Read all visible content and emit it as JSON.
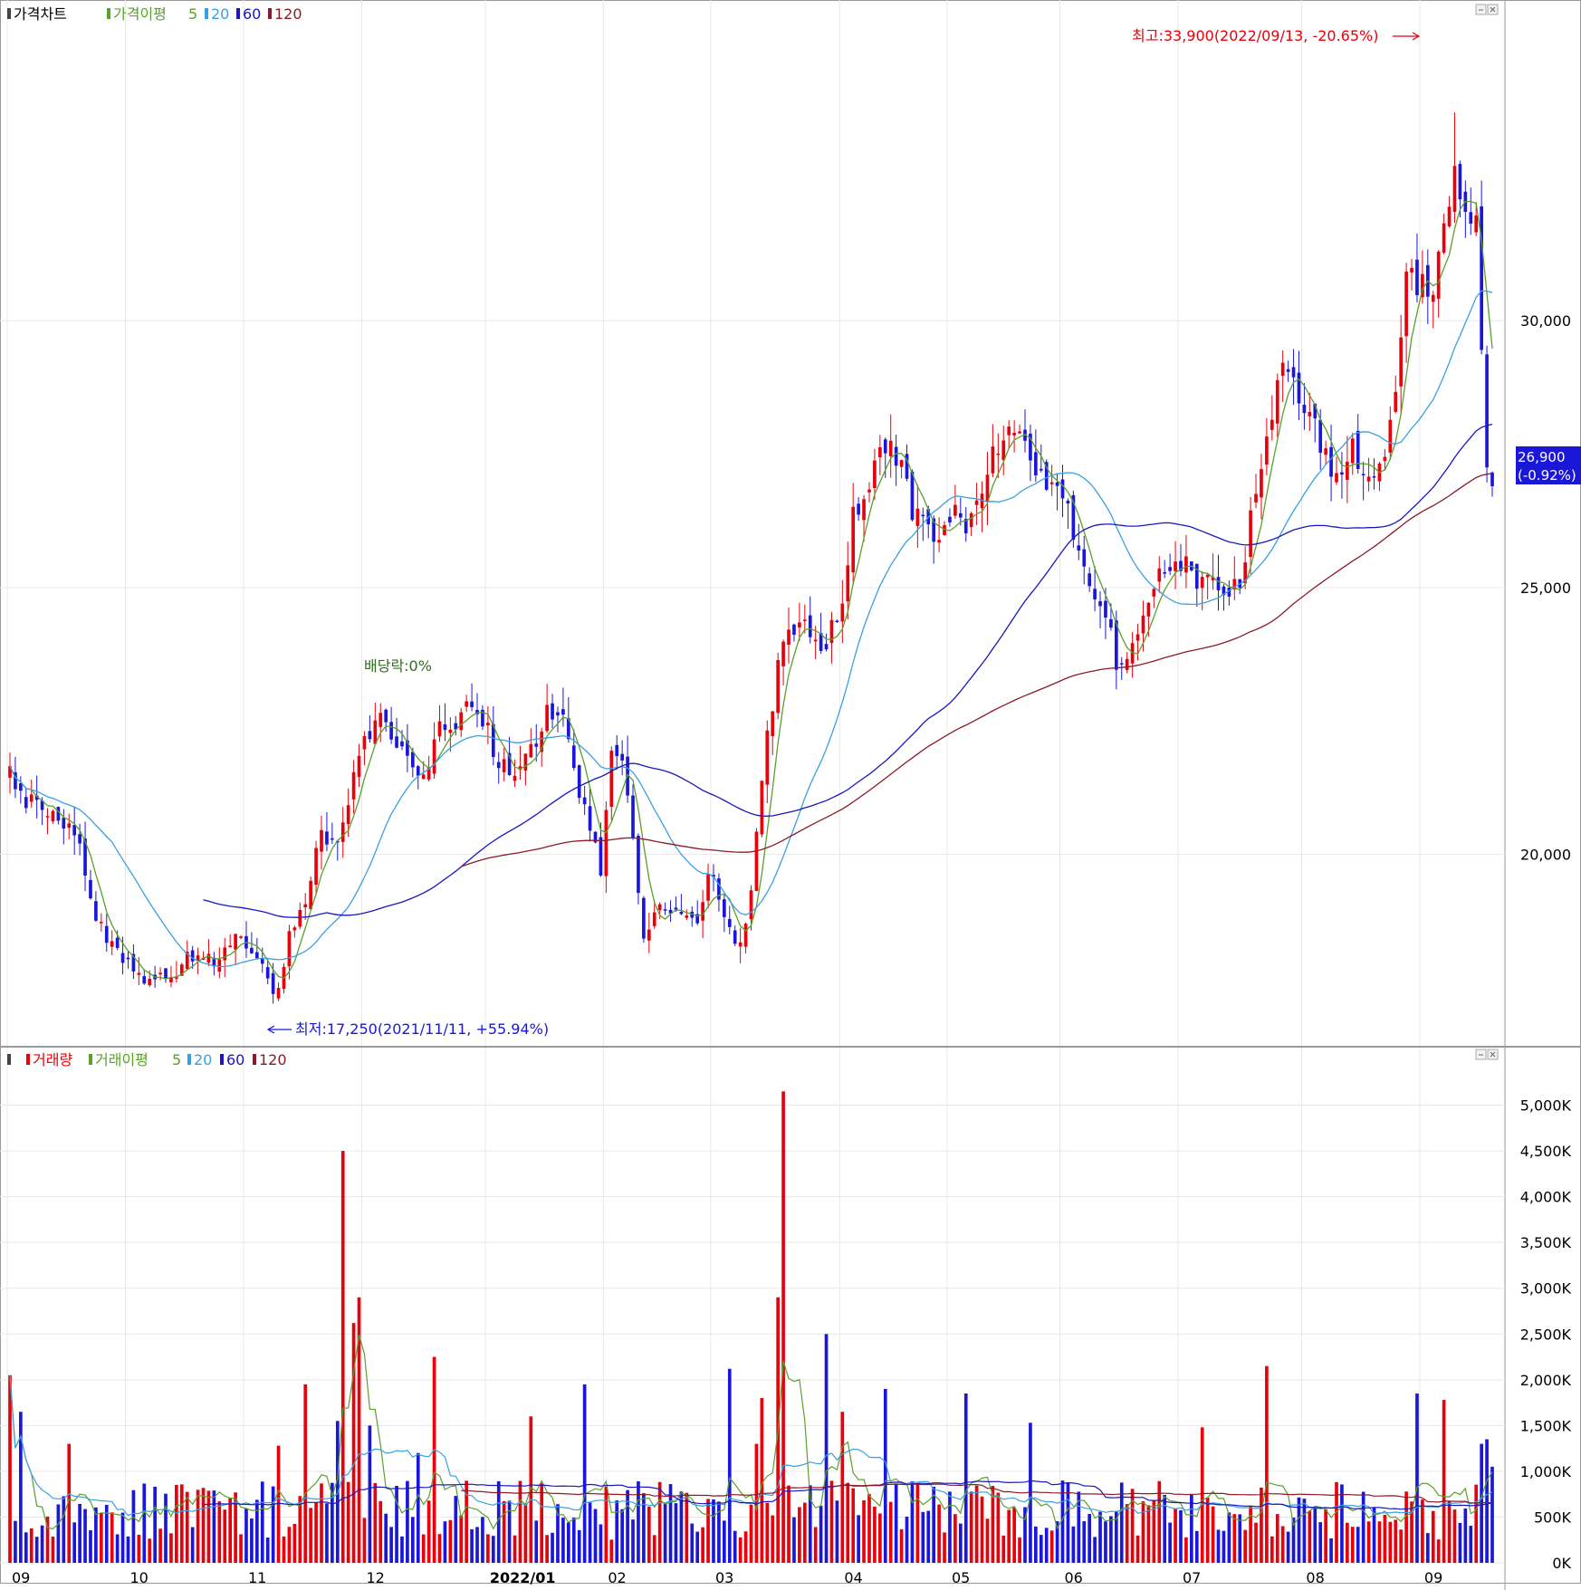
{
  "legend_price": {
    "name": "가격차트",
    "ma_label": "가격이평",
    "periods": [
      "5",
      "20",
      "60",
      "120"
    ]
  },
  "legend_volume": {
    "name": "거래량",
    "ma_label": "거래이평",
    "periods": [
      "5",
      "20",
      "60",
      "120"
    ]
  },
  "colors": {
    "up": "#e8000b",
    "down": "#1a17d8",
    "ma5": "#5aa02c",
    "ma20": "#3aa0e0",
    "ma60": "#1a17c0",
    "ma120": "#8b1a2a",
    "grid": "#e8e8e8"
  },
  "chart_data": [
    {
      "type": "candlestick",
      "name": "price",
      "ylim": [
        16500,
        35500
      ],
      "y_ticks": [
        20000,
        25000,
        30000
      ],
      "y_tick_labels": [
        "20,000",
        "25,000",
        "30,000"
      ],
      "x_month_labels": [
        "09",
        "10",
        "11",
        "12",
        "2022/01",
        "02",
        "03",
        "04",
        "05",
        "06",
        "07",
        "08",
        "09"
      ],
      "month_start_index": [
        0,
        22,
        44,
        66,
        89,
        111,
        131,
        155,
        175,
        196,
        218,
        241,
        263
      ],
      "bar_count": 277,
      "anchors": [
        [
          0,
          21500
        ],
        [
          3,
          21000
        ],
        [
          8,
          20700
        ],
        [
          12,
          20500
        ],
        [
          16,
          18700
        ],
        [
          22,
          18000
        ],
        [
          25,
          17600
        ],
        [
          30,
          17800
        ],
        [
          34,
          18100
        ],
        [
          38,
          18000
        ],
        [
          42,
          18400
        ],
        [
          46,
          18200
        ],
        [
          50,
          17250
        ],
        [
          52,
          18600
        ],
        [
          55,
          19200
        ],
        [
          58,
          20400
        ],
        [
          61,
          20200
        ],
        [
          64,
          21500
        ],
        [
          68,
          22600
        ],
        [
          71,
          22300
        ],
        [
          74,
          21900
        ],
        [
          77,
          21400
        ],
        [
          80,
          22600
        ],
        [
          83,
          22400
        ],
        [
          86,
          22900
        ],
        [
          88,
          22600
        ],
        [
          91,
          21700
        ],
        [
          94,
          21400
        ],
        [
          97,
          21900
        ],
        [
          100,
          22700
        ],
        [
          103,
          22500
        ],
        [
          106,
          21000
        ],
        [
          108,
          20600
        ],
        [
          110,
          19500
        ],
        [
          112,
          21800
        ],
        [
          114,
          21600
        ],
        [
          116,
          20300
        ],
        [
          118,
          18500
        ],
        [
          121,
          18900
        ],
        [
          124,
          18800
        ],
        [
          128,
          18700
        ],
        [
          130,
          19800
        ],
        [
          132,
          19200
        ],
        [
          134,
          18500
        ],
        [
          136,
          18200
        ],
        [
          138,
          19300
        ],
        [
          140,
          21500
        ],
        [
          142,
          22800
        ],
        [
          144,
          24200
        ],
        [
          146,
          24300
        ],
        [
          149,
          24200
        ],
        [
          152,
          23900
        ],
        [
          155,
          24900
        ],
        [
          157,
          26300
        ],
        [
          159,
          26600
        ],
        [
          161,
          27500
        ],
        [
          164,
          27600
        ],
        [
          166,
          27300
        ],
        [
          168,
          26500
        ],
        [
          170,
          26200
        ],
        [
          173,
          26000
        ],
        [
          176,
          26500
        ],
        [
          178,
          26100
        ],
        [
          181,
          26700
        ],
        [
          183,
          27700
        ],
        [
          186,
          27800
        ],
        [
          189,
          27900
        ],
        [
          192,
          27000
        ],
        [
          194,
          26900
        ],
        [
          196,
          26700
        ],
        [
          199,
          25700
        ],
        [
          202,
          24900
        ],
        [
          204,
          24600
        ],
        [
          206,
          23500
        ],
        [
          208,
          23700
        ],
        [
          210,
          24300
        ],
        [
          213,
          25100
        ],
        [
          216,
          25200
        ],
        [
          219,
          25600
        ],
        [
          221,
          25200
        ],
        [
          223,
          25300
        ],
        [
          226,
          24800
        ],
        [
          229,
          25100
        ],
        [
          231,
          26300
        ],
        [
          234,
          28000
        ],
        [
          237,
          29000
        ],
        [
          239,
          28900
        ],
        [
          242,
          28200
        ],
        [
          244,
          27700
        ],
        [
          247,
          27100
        ],
        [
          250,
          27700
        ],
        [
          253,
          26900
        ],
        [
          256,
          27300
        ],
        [
          258,
          28700
        ],
        [
          260,
          31200
        ],
        [
          262,
          30700
        ],
        [
          265,
          30400
        ],
        [
          267,
          32100
        ],
        [
          269,
          32400
        ],
        [
          271,
          32000
        ],
        [
          273,
          31800
        ],
        [
          275,
          27200
        ],
        [
          276,
          26900
        ]
      ],
      "annotations": {
        "high": "최고:33,900(2022/09/13, -20.65%)",
        "low": "최저:17,250(2021/11/11, +55.94%)",
        "dividend": "배당락:0%"
      },
      "last_price_label": "26,900",
      "last_change_label": "(-0.92%)"
    },
    {
      "type": "bar",
      "name": "volume",
      "ylim": [
        0,
        5500
      ],
      "y_ticks": [
        0,
        500,
        1000,
        1500,
        2000,
        2500,
        3000,
        3500,
        4000,
        4500,
        5000
      ],
      "y_tick_labels": [
        "0K",
        "500K",
        "1,000K",
        "1,500K",
        "2,000K",
        "2,500K",
        "3,000K",
        "3,500K",
        "4,000K",
        "4,500K",
        "5,000K"
      ],
      "unit": "K",
      "spikes": [
        [
          0,
          2050
        ],
        [
          2,
          1650
        ],
        [
          11,
          1300
        ],
        [
          50,
          1280
        ],
        [
          55,
          1950
        ],
        [
          61,
          1550
        ],
        [
          62,
          4500
        ],
        [
          64,
          2620
        ],
        [
          65,
          2900
        ],
        [
          67,
          1500
        ],
        [
          76,
          1200
        ],
        [
          79,
          2250
        ],
        [
          97,
          1600
        ],
        [
          107,
          1950
        ],
        [
          134,
          2120
        ],
        [
          139,
          1300
        ],
        [
          140,
          1800
        ],
        [
          143,
          2900
        ],
        [
          144,
          5150
        ],
        [
          152,
          2500
        ],
        [
          155,
          1650
        ],
        [
          163,
          1900
        ],
        [
          178,
          1850
        ],
        [
          190,
          1530
        ],
        [
          222,
          1480
        ],
        [
          234,
          2150
        ],
        [
          262,
          1850
        ],
        [
          267,
          1780
        ],
        [
          274,
          1300
        ],
        [
          275,
          1350
        ],
        [
          276,
          1050
        ]
      ]
    }
  ]
}
